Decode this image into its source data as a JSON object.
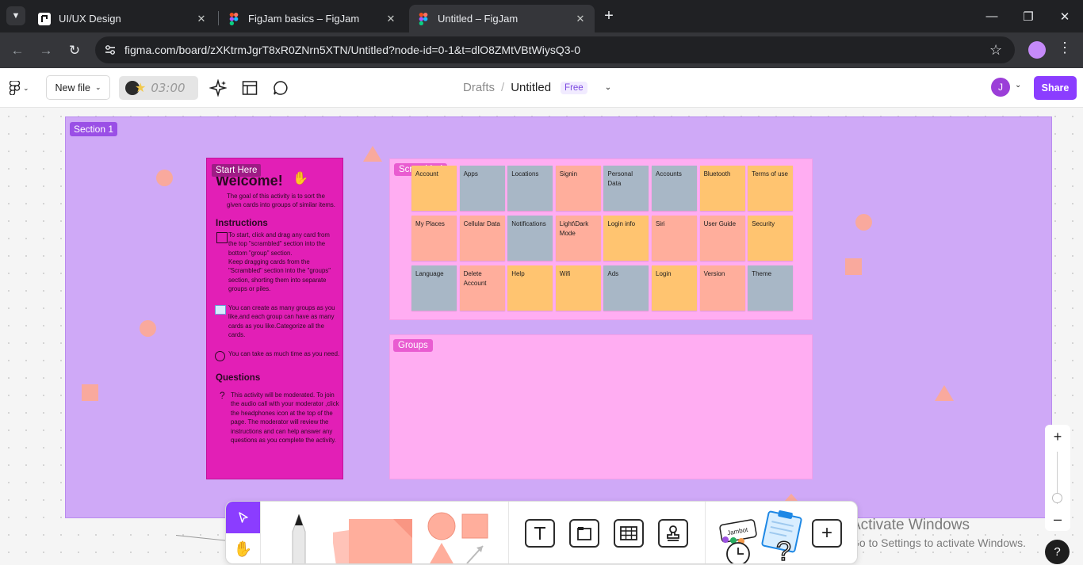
{
  "browser": {
    "tabs": [
      {
        "title": "UI/UX Design",
        "favicon": "ui-ux-favicon"
      },
      {
        "title": "FigJam basics – FigJam",
        "favicon": "figma-favicon"
      },
      {
        "title": "Untitled – FigJam",
        "favicon": "figma-favicon",
        "active": true
      }
    ],
    "url": "figma.com/board/zXKtrmJgrT8xR0ZNrn5XTN/Untitled?node-id=0-1&t=dlO8ZMtVBtWiysQ3-0"
  },
  "figma": {
    "new_file_label": "New file",
    "timer": "03:00",
    "breadcrumb": {
      "location": "Drafts",
      "separator": "/",
      "file_name": "Untitled",
      "plan": "Free"
    },
    "avatar_initial": "J",
    "share_label": "Share"
  },
  "canvas": {
    "section_label": "Section 1",
    "card": {
      "start_label": "Start Here",
      "welcome": "Welcome!",
      "intro": "The goal of this activity is to sort the given cards into groups of similar items.",
      "instructions_heading": "Instructions",
      "instruction_1a": "To start, click and drag any card from the top \"scrambled\" section into the bottom \"group\" section.",
      "instruction_1b": "Keep dragging cards from the \"Scrambled\" section into the \"groups\" section, shorting them into separate groups or piles.",
      "instruction_2": "You can create as many groups as you like,and each group can have as many cards as you like.Categorize all the cards.",
      "instruction_3": "You can take as much time as you need.",
      "questions_heading": "Questions",
      "question_text": "This activity will be moderated. To join the audio call with your moderator ,click the headphones icon at the top of the page. The moderator will review the instructions and can help answer any questions as you complete the activity."
    },
    "scrambled_label": "Scrambled",
    "groups_label": "Groups",
    "stickies": [
      {
        "text": "Account",
        "color": "#ffc470"
      },
      {
        "text": "Apps",
        "color": "#a8b7c6"
      },
      {
        "text": "Locations",
        "color": "#a8b7c6"
      },
      {
        "text": "Signin",
        "color": "#ffae9c"
      },
      {
        "text": "Personal Data",
        "color": "#a8b7c6"
      },
      {
        "text": "Accounts",
        "color": "#a8b7c6"
      },
      {
        "text": "Bluetooth",
        "color": "#ffc470"
      },
      {
        "text": "Terms of use",
        "color": "#ffc470"
      },
      {
        "text": "My Places",
        "color": "#ffae9c"
      },
      {
        "text": "Cellular Data",
        "color": "#ffae9c"
      },
      {
        "text": "Notifications",
        "color": "#a8b7c6"
      },
      {
        "text": "Light\\Dark Mode",
        "color": "#ffae9c"
      },
      {
        "text": "Login info",
        "color": "#ffc470"
      },
      {
        "text": "Siri",
        "color": "#ffae9c"
      },
      {
        "text": "User Guide",
        "color": "#ffae9c"
      },
      {
        "text": "Security",
        "color": "#ffc470"
      },
      {
        "text": "Language",
        "color": "#a8b7c6"
      },
      {
        "text": "Delete Account",
        "color": "#ffae9c"
      },
      {
        "text": "Help",
        "color": "#ffc470"
      },
      {
        "text": "Wifi",
        "color": "#ffc470"
      },
      {
        "text": "Ads",
        "color": "#a8b7c6"
      },
      {
        "text": "Login",
        "color": "#ffc470"
      },
      {
        "text": "Version",
        "color": "#ffae9c"
      },
      {
        "text": "Theme",
        "color": "#a8b7c6"
      }
    ]
  },
  "toolbar": {
    "jambot_label": "Jambot"
  },
  "watermark": {
    "line1": "Activate Windows",
    "line2": "Go to Settings to activate Windows."
  },
  "colors": {
    "accent": "#8b3dff",
    "section": "#cfa9f7",
    "card": "#e21fb6",
    "area": "#ffadf2"
  }
}
